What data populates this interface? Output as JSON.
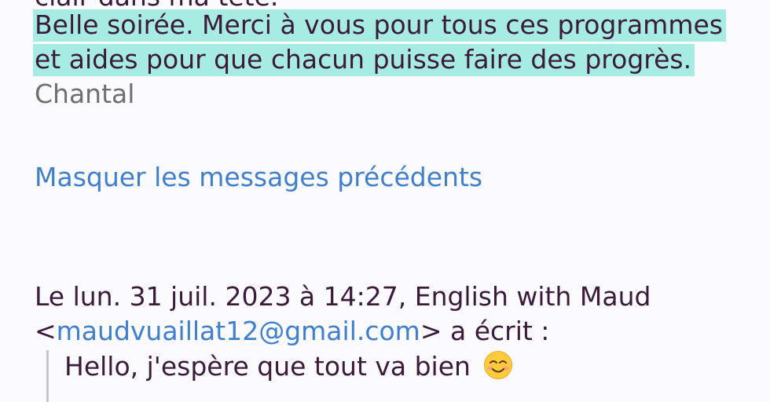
{
  "message": {
    "cut_off_line": "clair dans ma tête.",
    "body_line_1": "Belle soirée. Merci à vous pour tous ces programmes",
    "body_line_2": "et aides pour que chacun puisse faire des progrès.",
    "signature": "Chantal",
    "highlight_color": "#a6ece2"
  },
  "toggle_link": "Masquer les messages précédents",
  "quoted": {
    "header_line_1": "Le lun. 31 juil. 2023 à 14:27, English with Maud",
    "email_open": "<",
    "email": "maudvuaillat12@gmail.com",
    "header_suffix": "> a écrit :",
    "text": "Hello, j'espère que tout va bien",
    "emoji": "smiling-face-icon"
  },
  "colors": {
    "text": "#3b1a3b",
    "link": "#3f7fd0",
    "signature": "#6f6f6f",
    "background": "#fbfafe"
  }
}
